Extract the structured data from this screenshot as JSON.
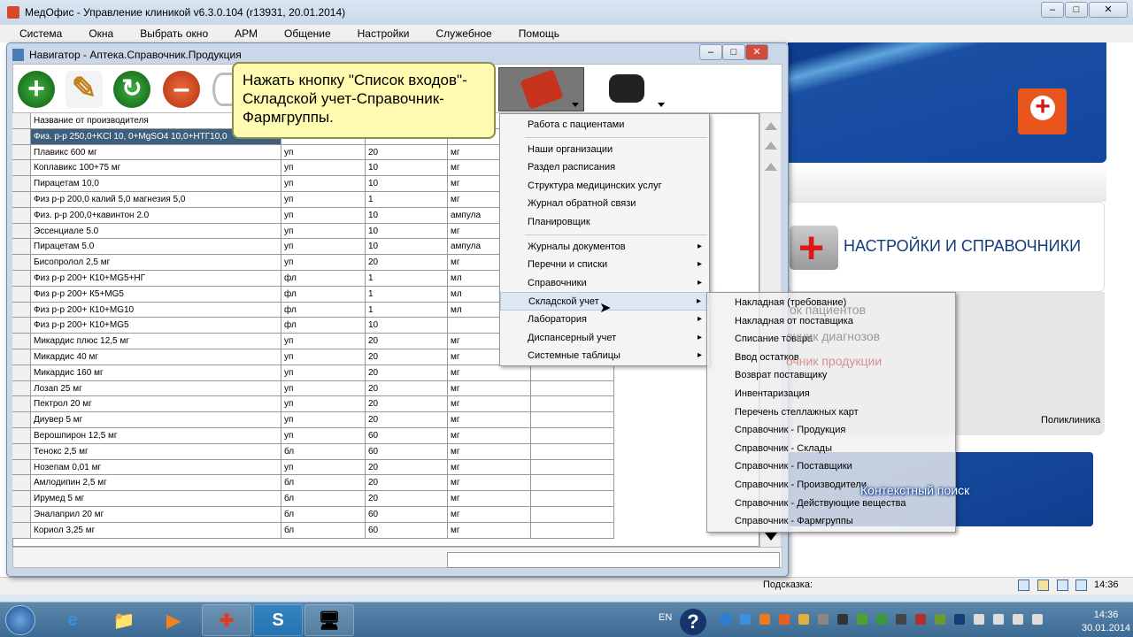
{
  "window": {
    "title": "МедОфис - Управление клиникой v6.3.0.104 (r13931, 20.01.2014)",
    "buttons": [
      "–",
      "□",
      "✕"
    ]
  },
  "menubar": [
    "Система",
    "Окна",
    "Выбрать окно",
    "АРМ",
    "Общение",
    "Настройки",
    "Служебное",
    "Помощь"
  ],
  "navigator": {
    "title": "Навигатор - Аптека.Справочник.Продукция",
    "window_buttons": [
      "–",
      "□",
      "✕"
    ]
  },
  "toolbar": {
    "add": "+",
    "edit": "✎",
    "refresh": "↻",
    "delete": "–"
  },
  "tooltip": "Нажать кнопку \"Список входов\"-Складской учет-Справочник-Фармгруппы.",
  "table": {
    "header": "Название от производителя",
    "rows": [
      [
        "Физ. р-р 250,0+KCl 10, 0+MgSO4 10,0+НТГ10,0",
        "",
        "",
        ""
      ],
      [
        "Плавикс 600 мг",
        "уп",
        "20",
        "мг"
      ],
      [
        "Коплавикс 100+75 мг",
        "уп",
        "10",
        "мг"
      ],
      [
        "Пирацетам 10,0",
        "уп",
        "10",
        "мг"
      ],
      [
        "Физ р-р 200,0 калий 5,0 магнезия 5,0",
        "уп",
        "1",
        "мг"
      ],
      [
        "Физ. р-р 200,0+кавинтон 2.0",
        "уп",
        "10",
        "ампула"
      ],
      [
        "Эссенциале 5.0",
        "уп",
        "10",
        "мг"
      ],
      [
        "Пирацетам 5.0",
        "уп",
        "10",
        "ампула"
      ],
      [
        "Бисопролол 2,5 мг",
        "уп",
        "20",
        "мг"
      ],
      [
        "Физ р-р 200+ К10+MG5+НГ",
        "фл",
        "1",
        "мл"
      ],
      [
        "Физ р-р 200+ К5+MG5",
        "фл",
        "1",
        "мл"
      ],
      [
        "Физ р-р 200+ К10+MG10",
        "фл",
        "1",
        "мл"
      ],
      [
        "Физ р-р 200+ К10+MG5",
        "фл",
        "10",
        ""
      ],
      [
        "Микардис плюс 12,5 мг",
        "уп",
        "20",
        "мг"
      ],
      [
        "Микардис 40 мг",
        "уп",
        "20",
        "мг"
      ],
      [
        "Микардис 160 мг",
        "уп",
        "20",
        "мг"
      ],
      [
        "Лозап 25 мг",
        "уп",
        "20",
        "мг"
      ],
      [
        "Пектрол 20 мг",
        "уп",
        "20",
        "мг"
      ],
      [
        "Диувер 5 мг",
        "уп",
        "20",
        "мг"
      ],
      [
        "Верошпирон 12,5 мг",
        "уп",
        "60",
        "мг"
      ],
      [
        "Тенокс 2,5 мг",
        "бл",
        "60",
        "мг"
      ],
      [
        "Нозепам 0,01 мг",
        "уп",
        "20",
        "мг"
      ],
      [
        "Амлодипин 2,5 мг",
        "бл",
        "20",
        "мг"
      ],
      [
        "Ирумед 5 мг",
        "бл",
        "20",
        "мг"
      ],
      [
        "Эналаприл 20 мг",
        "бл",
        "60",
        "мг"
      ],
      [
        "Кориол 3,25 мг",
        "бл",
        "60",
        "мг"
      ]
    ]
  },
  "menu1": {
    "groups": [
      [
        {
          "label": "Работа с пациентами",
          "sub": false
        }
      ],
      [
        {
          "label": "Наши организации",
          "sub": false
        },
        {
          "label": "Раздел расписания",
          "sub": false
        },
        {
          "label": "Структура медицинских услуг",
          "sub": false
        },
        {
          "label": "Журнал обратной связи",
          "sub": false
        },
        {
          "label": "Планировщик",
          "sub": false
        }
      ],
      [
        {
          "label": "Журналы документов",
          "sub": true
        },
        {
          "label": "Перечни и списки",
          "sub": true
        },
        {
          "label": "Справочники",
          "sub": true
        },
        {
          "label": "Складской учет",
          "sub": true,
          "active": true
        },
        {
          "label": "Лаборатория",
          "sub": true
        },
        {
          "label": "Диспансерный учет",
          "sub": true
        },
        {
          "label": "Системные таблицы",
          "sub": true
        }
      ]
    ]
  },
  "menu2": [
    "Накладная (требование)",
    "Накладная от поставщика",
    "Списание товара",
    "Ввод остатков",
    "Возврат поставщику",
    "Инвентаризация",
    "Перечень стеллажных карт",
    "Справочник - Продукция",
    "Справочник - Склады",
    "Справочник - Поставщики",
    "Справочник - Производители",
    "Справочник - Действующие вещества",
    "Справочник - Фармгруппы"
  ],
  "background": {
    "settings_title": "НАСТРОЙКИ И СПРАВОЧНИКИ",
    "ghost_items": [
      "ок пациентов",
      "очник диагнозов",
      "очник продукции"
    ],
    "clinic": "Поликлиника",
    "context_search": "Контекстный поиск"
  },
  "statusbar": {
    "hint": "Подсказка:",
    "time": "14:36"
  },
  "taskbar": {
    "lang": "EN",
    "help": "?",
    "time": "14:36",
    "date": "30.01.2014",
    "apps": [
      "e",
      "📁",
      "▶",
      "✚",
      "S",
      "🖥"
    ]
  }
}
